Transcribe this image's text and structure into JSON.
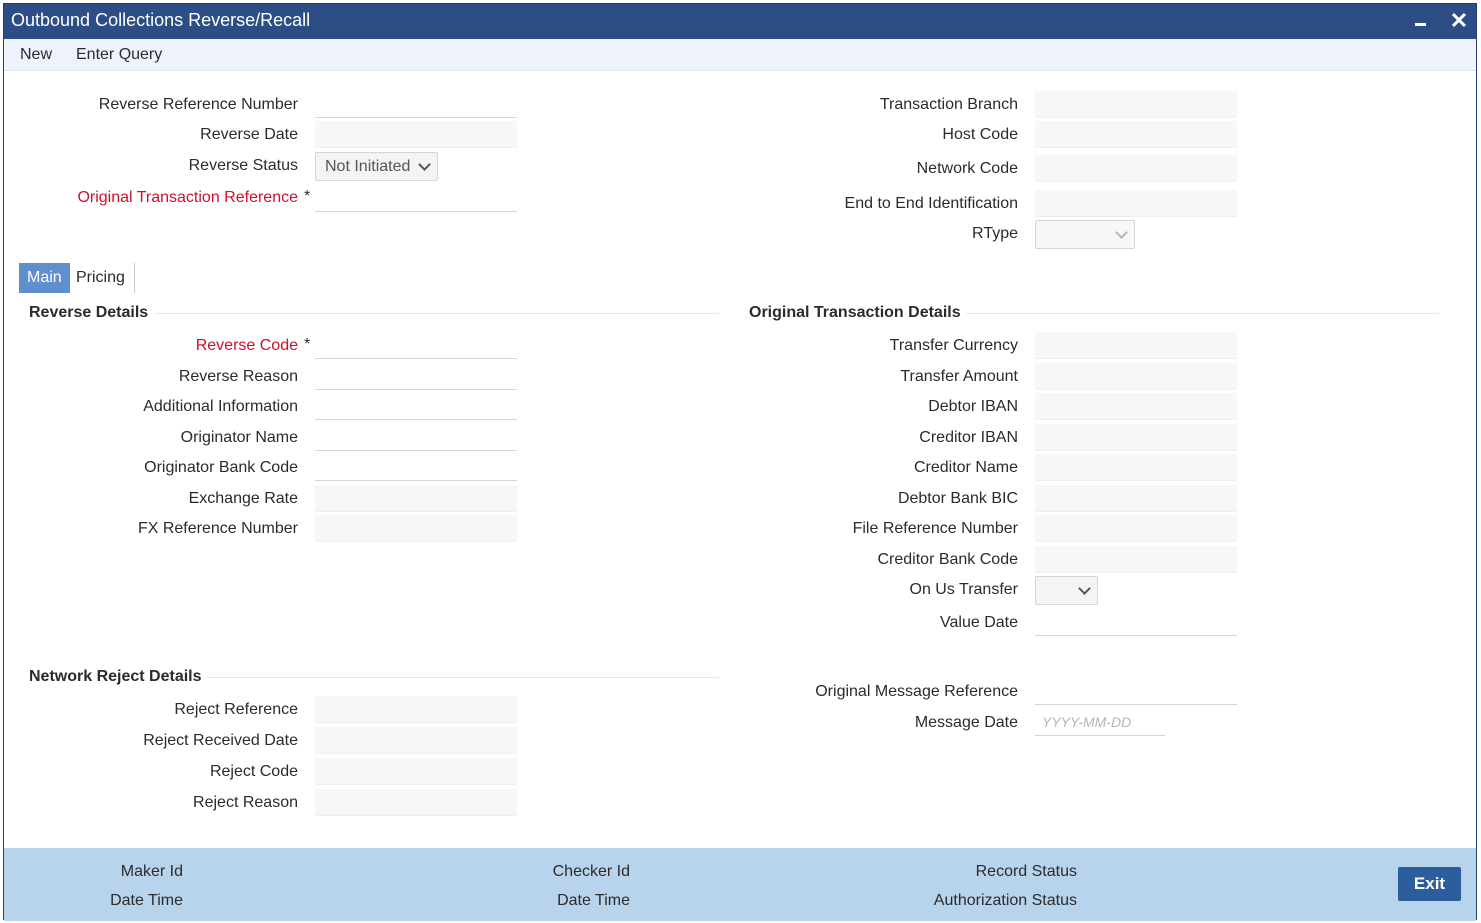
{
  "window": {
    "title": "Outbound Collections Reverse/Recall"
  },
  "menu": {
    "new": "New",
    "enter_query": "Enter Query"
  },
  "header_left": {
    "reverse_reference_number": "Reverse Reference Number",
    "reverse_date": "Reverse Date",
    "reverse_status": "Reverse Status",
    "reverse_status_value": "Not Initiated",
    "original_transaction_reference": "Original Transaction Reference"
  },
  "header_right": {
    "transaction_branch": "Transaction Branch",
    "host_code": "Host Code",
    "network_code": "Network Code",
    "end_to_end_identification": "End to End Identification",
    "rtype": "RType"
  },
  "tabs": {
    "main": "Main",
    "pricing": "Pricing"
  },
  "reverse_details": {
    "title": "Reverse Details",
    "reverse_code": "Reverse Code",
    "reverse_reason": "Reverse Reason",
    "additional_information": "Additional Information",
    "originator_name": "Originator Name",
    "originator_bank_code": "Originator Bank Code",
    "exchange_rate": "Exchange Rate",
    "fx_reference_number": "FX Reference Number"
  },
  "original_transaction_details": {
    "title": "Original Transaction Details",
    "transfer_currency": "Transfer Currency",
    "transfer_amount": "Transfer Amount",
    "debtor_iban": "Debtor IBAN",
    "creditor_iban": "Creditor IBAN",
    "creditor_name": "Creditor Name",
    "debtor_bank_bic": "Debtor Bank BIC",
    "file_reference_number": "File Reference Number",
    "creditor_bank_code": "Creditor Bank Code",
    "on_us_transfer": "On Us Transfer",
    "value_date": "Value Date",
    "original_message_reference": "Original Message Reference",
    "message_date": "Message Date",
    "message_date_placeholder": "YYYY-MM-DD"
  },
  "network_reject_details": {
    "title": "Network Reject Details",
    "reject_reference": "Reject Reference",
    "reject_received_date": "Reject Received Date",
    "reject_code": "Reject Code",
    "reject_reason": "Reject Reason"
  },
  "footer": {
    "maker_id": "Maker Id",
    "maker_date_time": "Date Time",
    "checker_id": "Checker Id",
    "checker_date_time": "Date Time",
    "record_status": "Record Status",
    "authorization_status": "Authorization Status",
    "exit": "Exit"
  },
  "required_marker": "*"
}
